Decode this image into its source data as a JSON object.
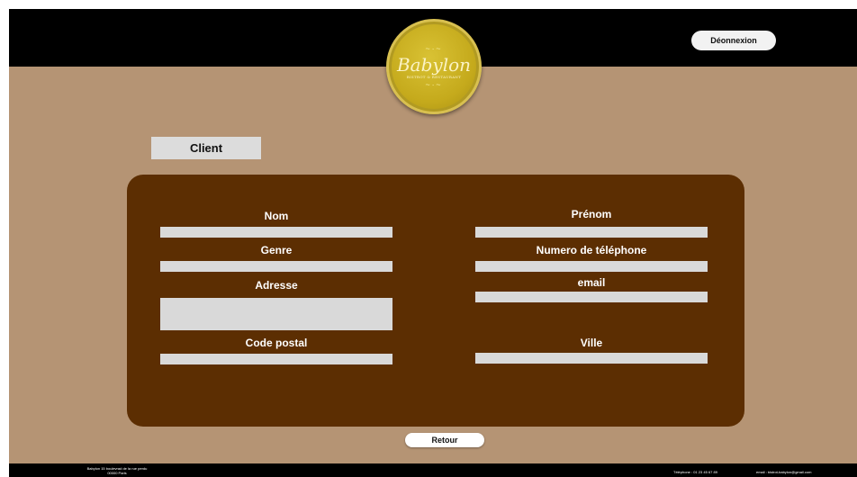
{
  "header": {
    "logout_label": "Déonnexion",
    "logo": {
      "name": "Babylon",
      "tagline": "BISTROT & RESTAURANT",
      "ornament": "~∙~"
    }
  },
  "section": {
    "title": "Client"
  },
  "form": {
    "fields": {
      "nom": {
        "label": "Nom",
        "value": ""
      },
      "prenom": {
        "label": "Prénom",
        "value": ""
      },
      "genre": {
        "label": "Genre",
        "value": ""
      },
      "telephone": {
        "label": "Numero de téléphone",
        "value": ""
      },
      "adresse": {
        "label": "Adresse",
        "value": ""
      },
      "email": {
        "label": "email",
        "value": ""
      },
      "code_postal": {
        "label": "Code postal",
        "value": ""
      },
      "ville": {
        "label": "Ville",
        "value": ""
      }
    }
  },
  "actions": {
    "back_label": "Retour"
  },
  "footer": {
    "address_line1": "Babylon 15 boulevrad de la rue perdu",
    "address_line2": "00000 Paris",
    "phone": "Téléphone : 01 23 45 67 89",
    "email": "email : bistrot-babylon@gmail.com"
  },
  "colors": {
    "background": "#b59474",
    "panel": "#5c2e02",
    "topbar": "#000000",
    "input": "#d9d9d9",
    "logo_gold": "#c5aa1c"
  }
}
